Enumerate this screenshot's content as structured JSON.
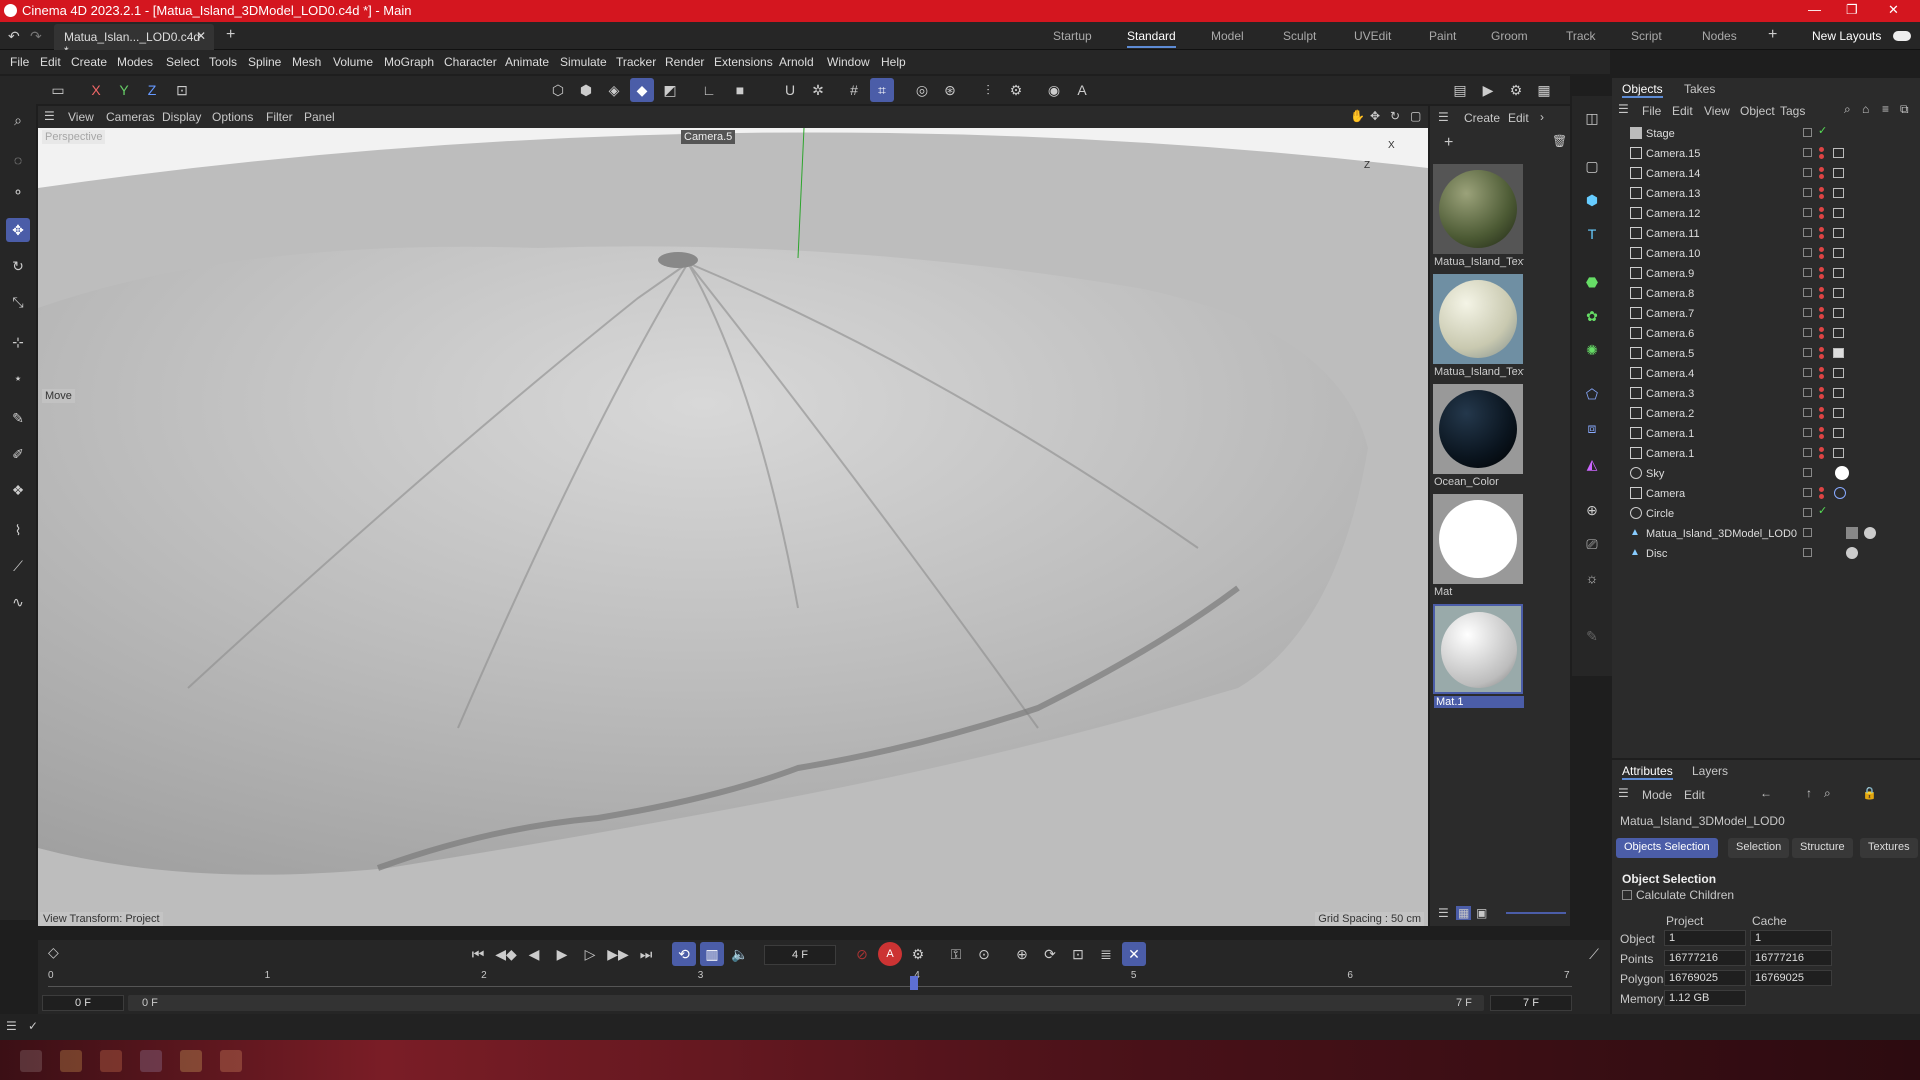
{
  "window": {
    "title": "Cinema 4D 2023.2.1 - [Matua_Island_3DModel_LOD0.c4d *] - Main",
    "controls": [
      "—",
      "❐",
      "✕"
    ]
  },
  "tabs": {
    "document": "Matua_Islan..._LOD0.c4d *",
    "layouts": [
      "Startup",
      "Standard",
      "Model",
      "Sculpt",
      "UVEdit",
      "Paint",
      "Groom",
      "Track",
      "Script",
      "Nodes"
    ],
    "active_layout": "Standard",
    "new_layouts": "New Layouts"
  },
  "menu": [
    "File",
    "Edit",
    "Create",
    "Modes",
    "Select",
    "Tools",
    "Spline",
    "Mesh",
    "Volume",
    "MoGraph",
    "Character",
    "Animate",
    "Simulate",
    "Tracker",
    "Render",
    "Extensions",
    "Arnold",
    "Window",
    "Help"
  ],
  "coord_toolbar": [
    "X",
    "Y",
    "Z"
  ],
  "viewport": {
    "menu": [
      "View",
      "Cameras",
      "Display",
      "Options",
      "Filter",
      "Panel"
    ],
    "view_name": "Perspective",
    "camera_label": "Camera.5",
    "tool_label": "Move",
    "transform_label": "View Transform: Project",
    "grid_label": "Grid Spacing : 50 cm",
    "axis_z": "Z",
    "axis_x": "X"
  },
  "materials": {
    "menu": [
      "Create",
      "Edit"
    ],
    "items": [
      {
        "name": "Matua_Island_Text",
        "color": "#5b6b3f"
      },
      {
        "name": "Matua_Island_Text",
        "color": "#dcdcc8"
      },
      {
        "name": "Ocean_Color",
        "color": "#0f1e2e"
      },
      {
        "name": "Mat",
        "color": "#ffffff"
      },
      {
        "name": "Mat.1",
        "color": "#e6e6e6"
      }
    ],
    "selected": "Mat.1"
  },
  "objects_panel": {
    "tabs": [
      "Objects",
      "Takes"
    ],
    "menu": [
      "File",
      "Edit",
      "View",
      "Object",
      "Tags"
    ],
    "items": [
      "Stage",
      "Camera.15",
      "Camera.14",
      "Camera.13",
      "Camera.12",
      "Camera.11",
      "Camera.10",
      "Camera.9",
      "Camera.8",
      "Camera.7",
      "Camera.6",
      "Camera.5",
      "Camera.4",
      "Camera.3",
      "Camera.2",
      "Camera.1",
      "Camera.1",
      "Sky",
      "Camera",
      "Circle",
      "Matua_Island_3DModel_LOD0",
      "Disc"
    ]
  },
  "attributes": {
    "tabs": [
      "Attributes",
      "Layers"
    ],
    "menu": [
      "Mode",
      "Edit"
    ],
    "object_name": "Matua_Island_3DModel_LOD0",
    "sub_tabs": [
      "Objects Selection",
      "Selection",
      "Structure",
      "Textures"
    ],
    "section": "Object Selection",
    "calc_children": "Calculate Children",
    "col_project": "Project",
    "col_cache": "Cache",
    "rows": [
      {
        "label": "Object",
        "project": "1",
        "cache": "1"
      },
      {
        "label": "Points",
        "project": "16777216",
        "cache": "16777216"
      },
      {
        "label": "Polygons",
        "project": "16769025",
        "cache": "16769025"
      },
      {
        "label": "Memory",
        "project": "1.12 GB",
        "cache": ""
      }
    ]
  },
  "timeline": {
    "current_frame": "4 F",
    "ruler": [
      "0",
      "1",
      "2",
      "3",
      "4",
      "5",
      "6",
      "7"
    ],
    "playhead_frame": 4,
    "frame_max": 7,
    "start": "0 F",
    "start2": "0 F",
    "end": "7 F",
    "end2": "7 F"
  }
}
